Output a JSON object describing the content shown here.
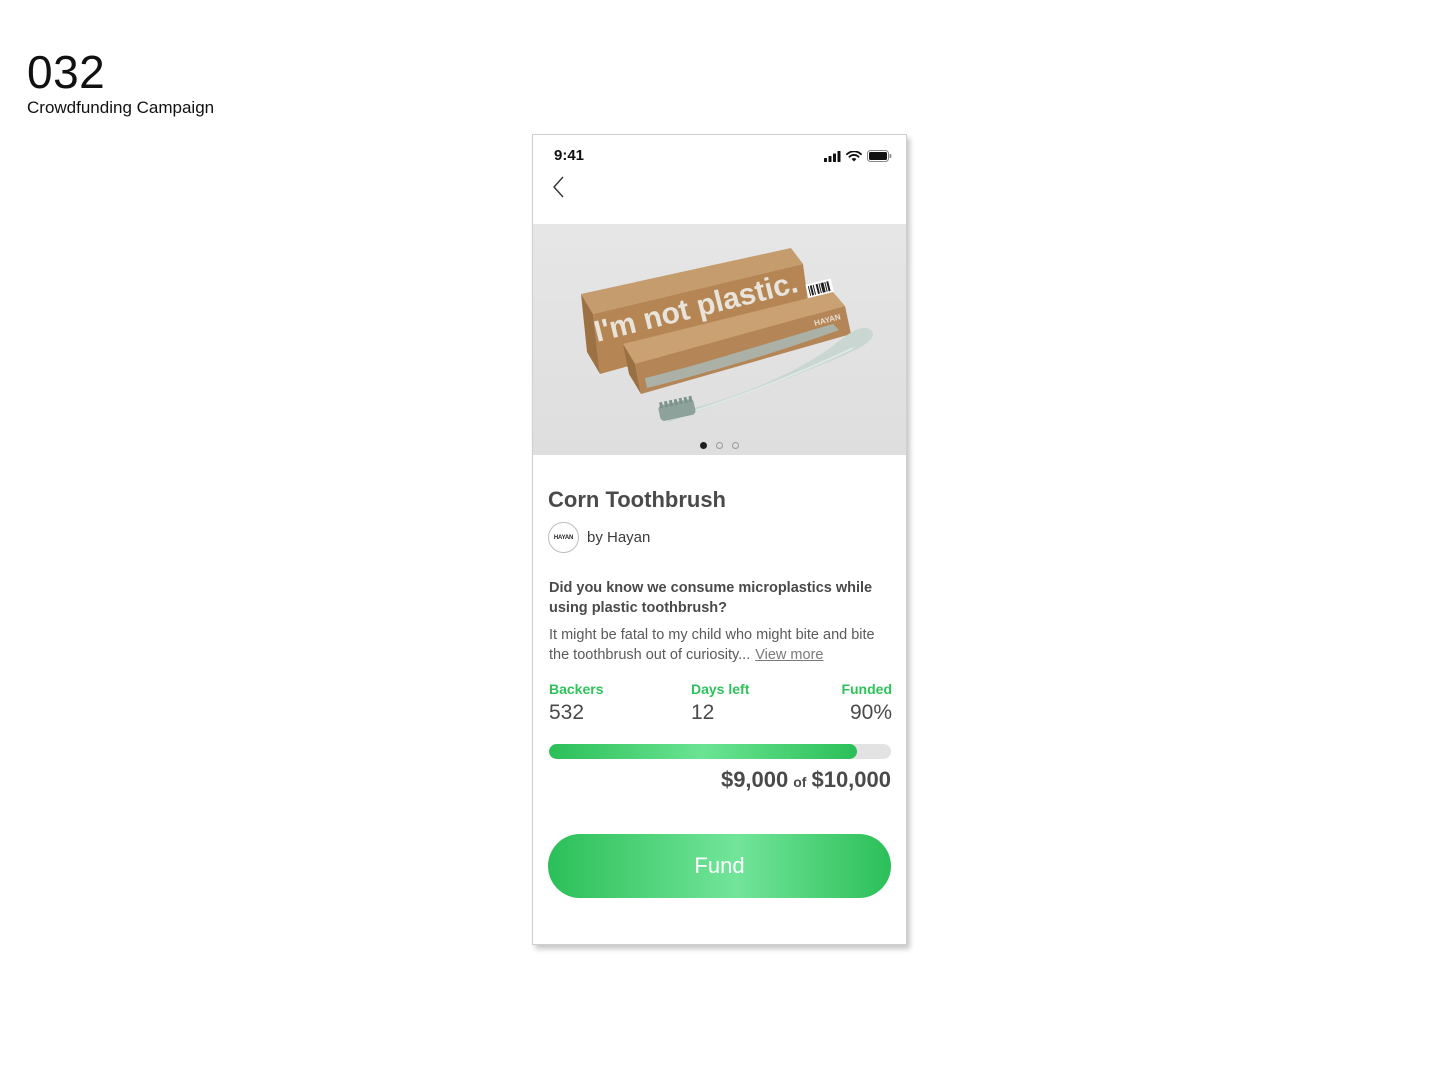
{
  "page": {
    "number": "032",
    "subtitle": "Crowdfunding Campaign"
  },
  "status_bar": {
    "time": "9:41"
  },
  "hero": {
    "box_text": "I'm not plastic.",
    "brand_mark": "HAYAN",
    "carousel_total": 3,
    "carousel_active": 1
  },
  "project": {
    "title": "Corn Toothbrush",
    "creator": "by Hayan",
    "avatar_text": "HAYAN",
    "question": "Did you know we consume microplastics while using plastic toothbrush?",
    "description": "It might be fatal to my child who might bite and bite the toothbrush out of curiosity...",
    "view_more": "View more"
  },
  "stats": {
    "backers_label": "Backers",
    "backers_value": "532",
    "days_label": "Days left",
    "days_value": "12",
    "funded_label": "Funded",
    "funded_value": "90%",
    "progress_fraction": 0.9
  },
  "funding": {
    "raised": "$9,000",
    "of": "of",
    "goal": "$10,000"
  },
  "cta": {
    "fund_label": "Fund"
  },
  "colors": {
    "accent": "#2dc35a",
    "text": "#4a4a4a"
  }
}
